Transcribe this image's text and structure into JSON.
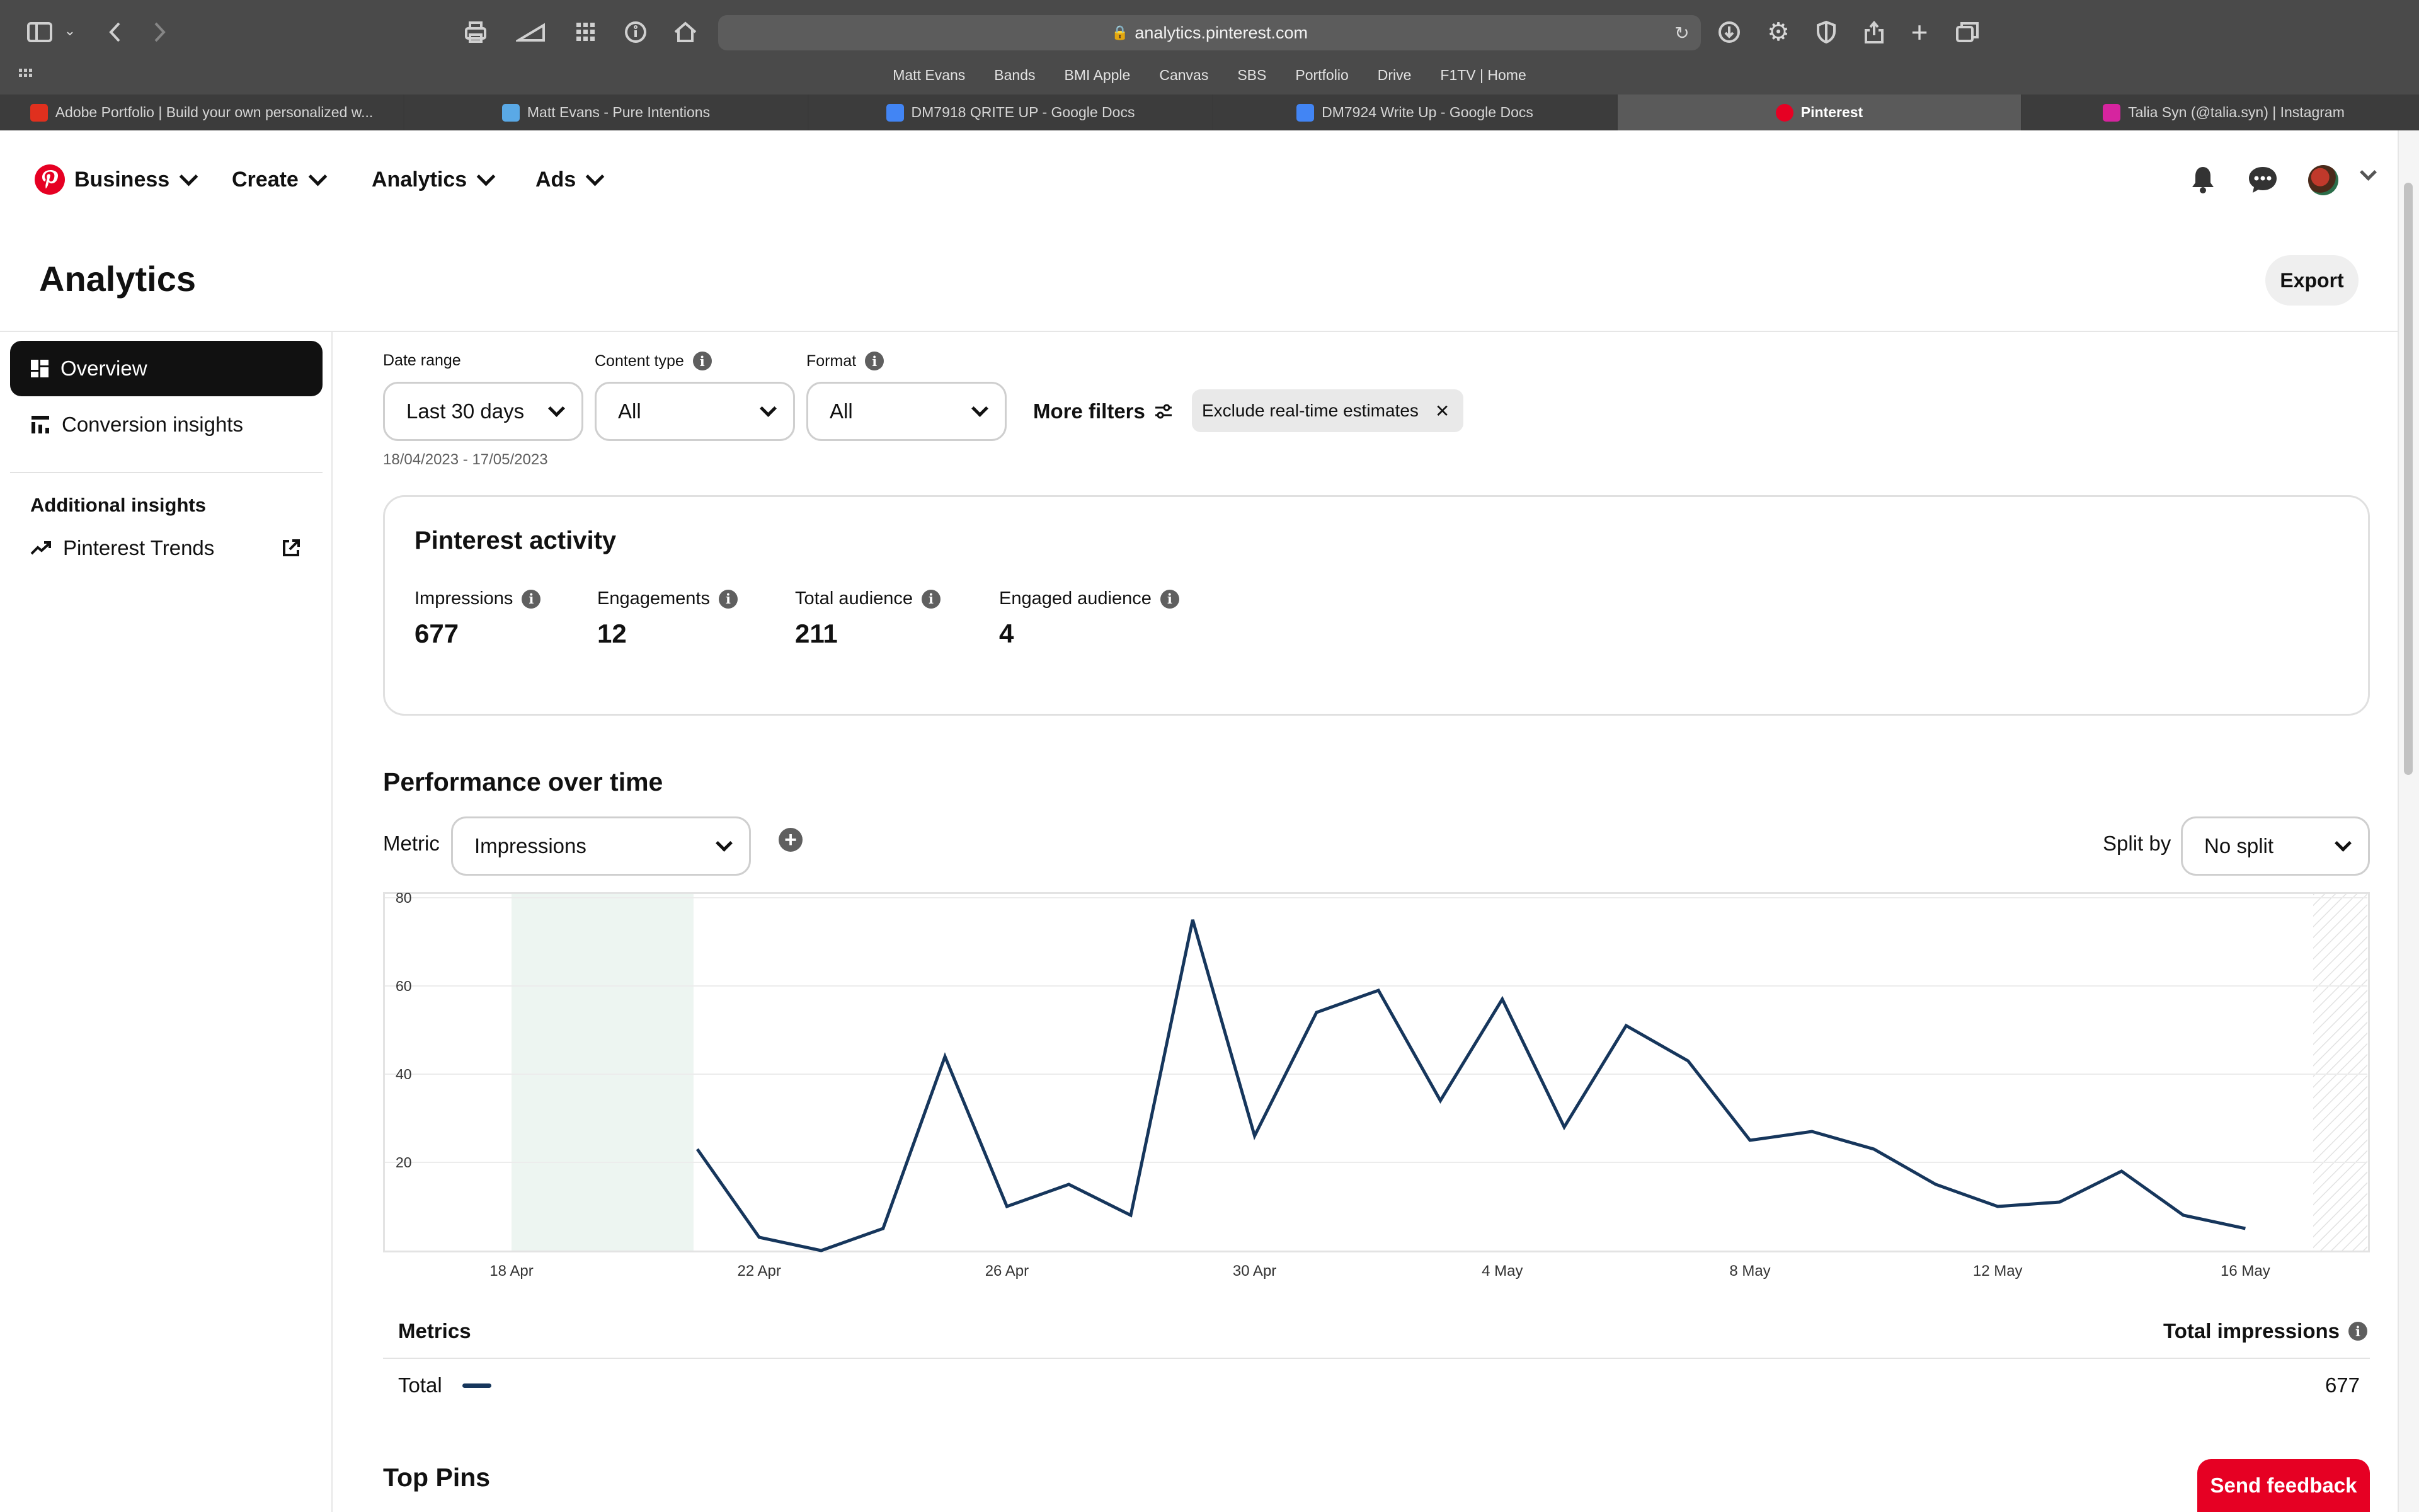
{
  "browser": {
    "url": "analytics.pinterest.com",
    "bookmarks": [
      "Matt Evans",
      "Bands",
      "BMI Apple",
      "Canvas",
      "SBS",
      "Portfolio",
      "Drive",
      "F1TV | Home"
    ],
    "tabs": [
      {
        "label": "Adobe Portfolio | Build your own personalized w...",
        "color": "#e0301e"
      },
      {
        "label": "Matt Evans - Pure Intentions",
        "color": "#5aa9e6"
      },
      {
        "label": "DM7918 QRITE UP - Google Docs",
        "color": "#4285f4"
      },
      {
        "label": "DM7924 Write Up - Google Docs",
        "color": "#4285f4"
      },
      {
        "label": "Pinterest",
        "color": "#e60023",
        "active": true
      },
      {
        "label": "Talia Syn (@talia.syn) | Instagram",
        "color": "#d6249f"
      }
    ]
  },
  "topnav": {
    "business": "Business",
    "create": "Create",
    "analytics": "Analytics",
    "ads": "Ads"
  },
  "page": {
    "title": "Analytics",
    "export_label": "Export"
  },
  "sidebar": {
    "items": [
      {
        "label": "Overview",
        "active": true
      },
      {
        "label": "Conversion insights"
      }
    ],
    "additional_heading": "Additional insights",
    "trends_label": "Pinterest Trends"
  },
  "filters": {
    "date_range_label": "Date range",
    "date_range_value": "Last 30 days",
    "content_type_label": "Content type",
    "content_type_value": "All",
    "format_label": "Format",
    "format_value": "All",
    "more_filters": "More filters",
    "chip_label": "Exclude real-time estimates",
    "date_span": "18/04/2023 - 17/05/2023"
  },
  "activity": {
    "title": "Pinterest activity",
    "stats": [
      {
        "label": "Impressions",
        "value": "677"
      },
      {
        "label": "Engagements",
        "value": "12"
      },
      {
        "label": "Total audience",
        "value": "211"
      },
      {
        "label": "Engaged audience",
        "value": "4"
      }
    ]
  },
  "performance": {
    "title": "Performance over time",
    "metric_label": "Metric",
    "metric_value": "Impressions",
    "split_label": "Split by",
    "split_value": "No split"
  },
  "chart_data": {
    "type": "line",
    "x_tick_labels": [
      "18 Apr",
      "22 Apr",
      "26 Apr",
      "30 Apr",
      "4 May",
      "8 May",
      "12 May",
      "16 May"
    ],
    "y_ticks": [
      20,
      40,
      60,
      80
    ],
    "ylim": [
      0,
      80
    ],
    "grid": true,
    "series": [
      {
        "color": "#16365c",
        "x": [
          "21 Apr",
          "22 Apr",
          "23 Apr",
          "24 Apr",
          "25 Apr",
          "26 Apr",
          "27 Apr",
          "28 Apr",
          "29 Apr",
          "30 Apr",
          "1 May",
          "2 May",
          "3 May",
          "4 May",
          "5 May",
          "6 May",
          "7 May",
          "8 May",
          "9 May",
          "10 May",
          "11 May",
          "12 May",
          "13 May",
          "14 May",
          "15 May",
          "16 May"
        ],
        "values": [
          23,
          3,
          0,
          5,
          44,
          10,
          15,
          8,
          75,
          26,
          54,
          59,
          34,
          57,
          28,
          51,
          43,
          25,
          27,
          23,
          15,
          10,
          11,
          18,
          8,
          5
        ]
      }
    ],
    "highlight_range": [
      "18 Apr",
      "21 Apr"
    ],
    "highlight_color": "#edf5f1"
  },
  "metrics_table": {
    "heading": "Metrics",
    "total_heading": "Total impressions",
    "row_label": "Total",
    "row_value": "677"
  },
  "top_pins_title": "Top Pins",
  "feedback_label": "Send feedback",
  "colors": {
    "brand": "#e60023",
    "line": "#16365c"
  }
}
